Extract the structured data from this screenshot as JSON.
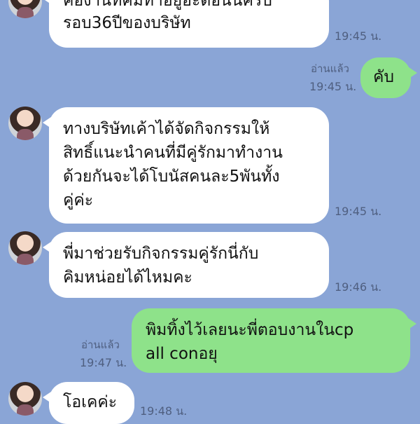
{
  "messages": [
    {
      "side": "in",
      "lines": [
        "คืองานที่คิมทำอยู่อะตอนนี้ครบ",
        "รอบ36ปีของบริษัท"
      ],
      "time": "19:45 น."
    },
    {
      "side": "out",
      "lines": [
        "คับ"
      ],
      "time": "19:45 น.",
      "read": "อ่านแล้ว"
    },
    {
      "side": "in",
      "lines": [
        "ทางบริษัทเค้าได้จัดกิจกรรมให้",
        "สิทธิ์แนะนำคนที่มีคู่รักมาทำงาน",
        "ด้วยกันจะได้โบนัสคนละ5พันทั้ง",
        "คู่ค่ะ"
      ],
      "time": "19:45 น."
    },
    {
      "side": "in",
      "lines": [
        "พี่มาช่วยรับกิจกรรมคู่รักนี่กับ",
        "คิมหน่อยได้ไหมคะ"
      ],
      "time": "19:46 น."
    },
    {
      "side": "out",
      "lines": [
        "พิมทิ้งไว้เลยนะพี่ตอบงานในcp",
        "all conอยุ"
      ],
      "time": "19:47 น.",
      "read": "อ่านแล้ว"
    },
    {
      "side": "in",
      "lines": [
        "โอเคค่ะ"
      ],
      "time": "19:48 น."
    }
  ]
}
